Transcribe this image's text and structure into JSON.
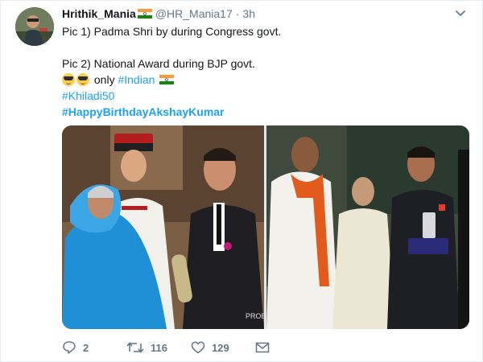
{
  "tweet": {
    "display_name": "Hrithik_Mania",
    "handle": "@HR_Mania17",
    "separator": "·",
    "time": "3h",
    "lines": {
      "line1": "Pic 1) Padma Shri by during Congress govt.",
      "line2": "Pic 2) National Award during BJP govt.",
      "line3_text": "only",
      "line3_link": "#Indian",
      "hashtag1": "#Khiladi50",
      "hashtag2": "#HappyBirthdayAkshayKumar"
    },
    "watermark": "PROBHK",
    "counts": {
      "replies": "2",
      "retweets": "116",
      "likes": "129"
    }
  },
  "icons": {
    "flag": "indian-flag-icon",
    "emoji": "sunglasses-emoji-icon",
    "caret": "chevron-down-icon",
    "reply": "reply-icon",
    "retweet": "retweet-icon",
    "like": "heart-icon",
    "dm": "envelope-icon"
  },
  "colors": {
    "link": "#1da1f2",
    "muted": "#657786",
    "text": "#14171a"
  }
}
